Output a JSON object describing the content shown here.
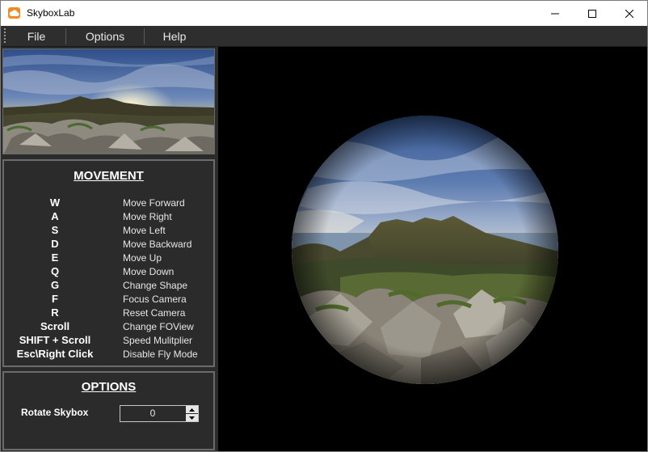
{
  "window": {
    "title": "SkyboxLab"
  },
  "menu": [
    "File",
    "Options",
    "Help"
  ],
  "movement": {
    "title": "MOVEMENT",
    "rows": [
      {
        "key": "W",
        "action": "Move Forward"
      },
      {
        "key": "A",
        "action": "Move Right"
      },
      {
        "key": "S",
        "action": "Move Left"
      },
      {
        "key": "D",
        "action": "Move Backward"
      },
      {
        "key": "E",
        "action": "Move Up"
      },
      {
        "key": "Q",
        "action": "Move Down"
      },
      {
        "key": "G",
        "action": "Change Shape"
      },
      {
        "key": "F",
        "action": "Focus Camera"
      },
      {
        "key": "R",
        "action": "Reset Camera"
      },
      {
        "key": "Scroll",
        "action": "Change FOView"
      },
      {
        "key": "SHIFT + Scroll",
        "action": "Speed Mulitplier"
      },
      {
        "key": "Esc\\Right Click",
        "action": "Disable Fly Mode"
      }
    ]
  },
  "options": {
    "title": "OPTIONS",
    "rotate_label": "Rotate Skybox",
    "rotate_value": "0"
  },
  "colors": {
    "app_icon": "#f08a24",
    "panel_bg": "#2b2b2b",
    "panel_border": "#6b6b6b",
    "viewport_bg": "#000000"
  }
}
